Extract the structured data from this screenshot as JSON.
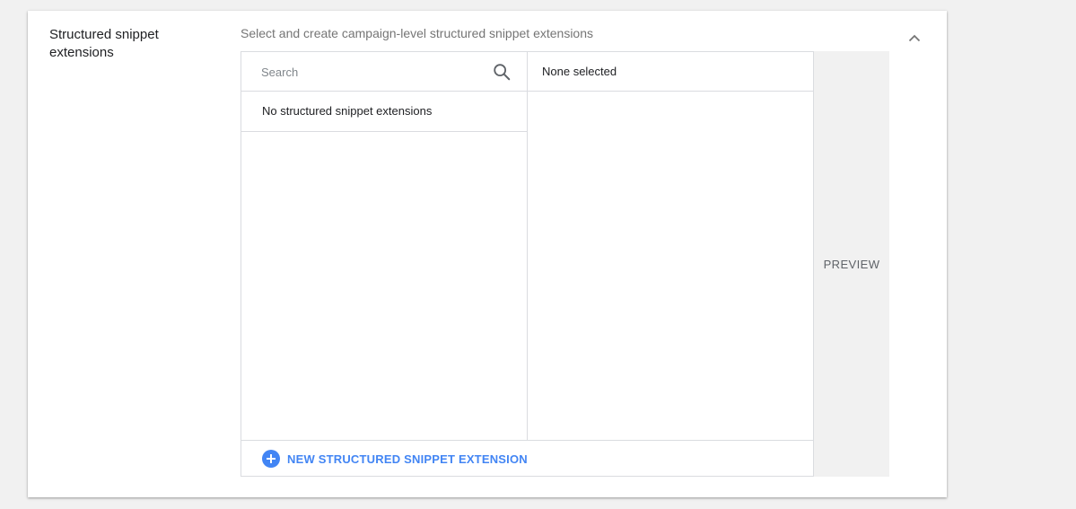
{
  "section": {
    "title": "Structured snippet extensions",
    "subtitle": "Select and create campaign-level structured snippet extensions",
    "collapse_icon": "chevron-up-icon"
  },
  "selector": {
    "search": {
      "placeholder": "Search",
      "value": "",
      "icon": "search-icon"
    },
    "available": {
      "empty_text": "No structured snippet extensions"
    },
    "selected": {
      "status_text": "None selected"
    },
    "footer": {
      "new_label": "NEW STRUCTURED SNIPPET EXTENSION",
      "icon": "plus-circle-icon"
    }
  },
  "preview": {
    "label": "PREVIEW"
  },
  "colors": {
    "accent": "#4285f4",
    "border": "#dadce0",
    "muted_text": "#757575",
    "preview_bg": "#f1f1f1"
  }
}
